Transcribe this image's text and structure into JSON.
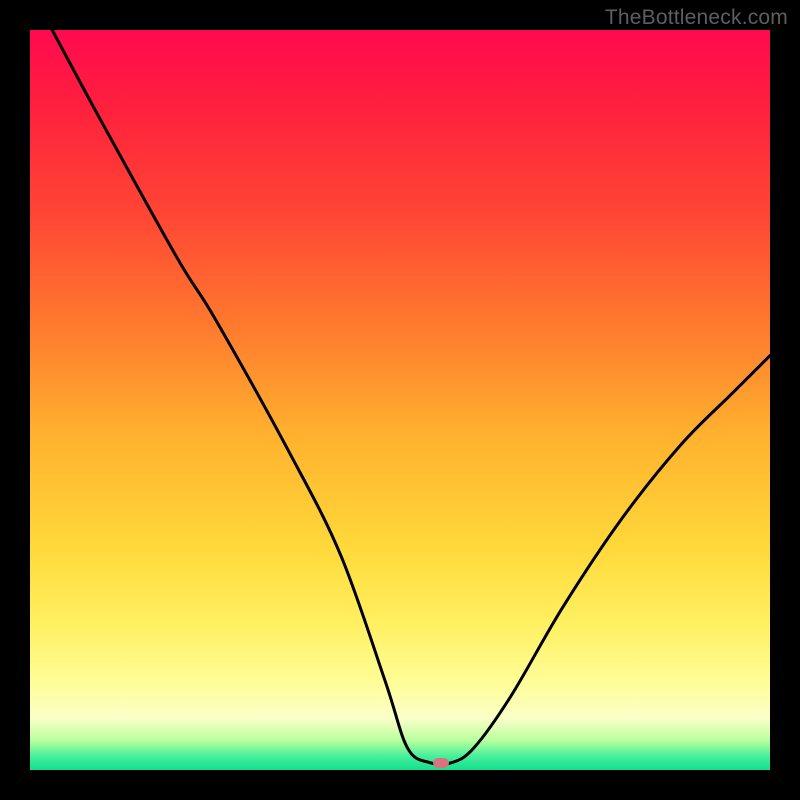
{
  "attribution": "TheBottleneck.com",
  "chart_data": {
    "type": "line",
    "title": "",
    "xlabel": "",
    "ylabel": "",
    "xlim": [
      0,
      100
    ],
    "ylim": [
      0,
      100
    ],
    "series": [
      {
        "name": "bottleneck-curve",
        "x": [
          3,
          10,
          20,
          25,
          35,
          42,
          48,
          51,
          54,
          57,
          60,
          65,
          72,
          80,
          88,
          95,
          100
        ],
        "y": [
          100,
          87,
          69,
          61,
          43,
          29,
          12,
          3,
          1,
          1,
          3,
          10,
          22,
          34,
          44,
          51,
          56
        ]
      }
    ],
    "marker": {
      "x": 55.5,
      "y": 1
    },
    "gradient_stops": [
      {
        "pct": 0,
        "color": "#ff0a4f"
      },
      {
        "pct": 25,
        "color": "#ff4634"
      },
      {
        "pct": 55,
        "color": "#ffb22e"
      },
      {
        "pct": 80,
        "color": "#fff060"
      },
      {
        "pct": 96,
        "color": "#b9ff9e"
      },
      {
        "pct": 100,
        "color": "#11e08f"
      }
    ]
  }
}
